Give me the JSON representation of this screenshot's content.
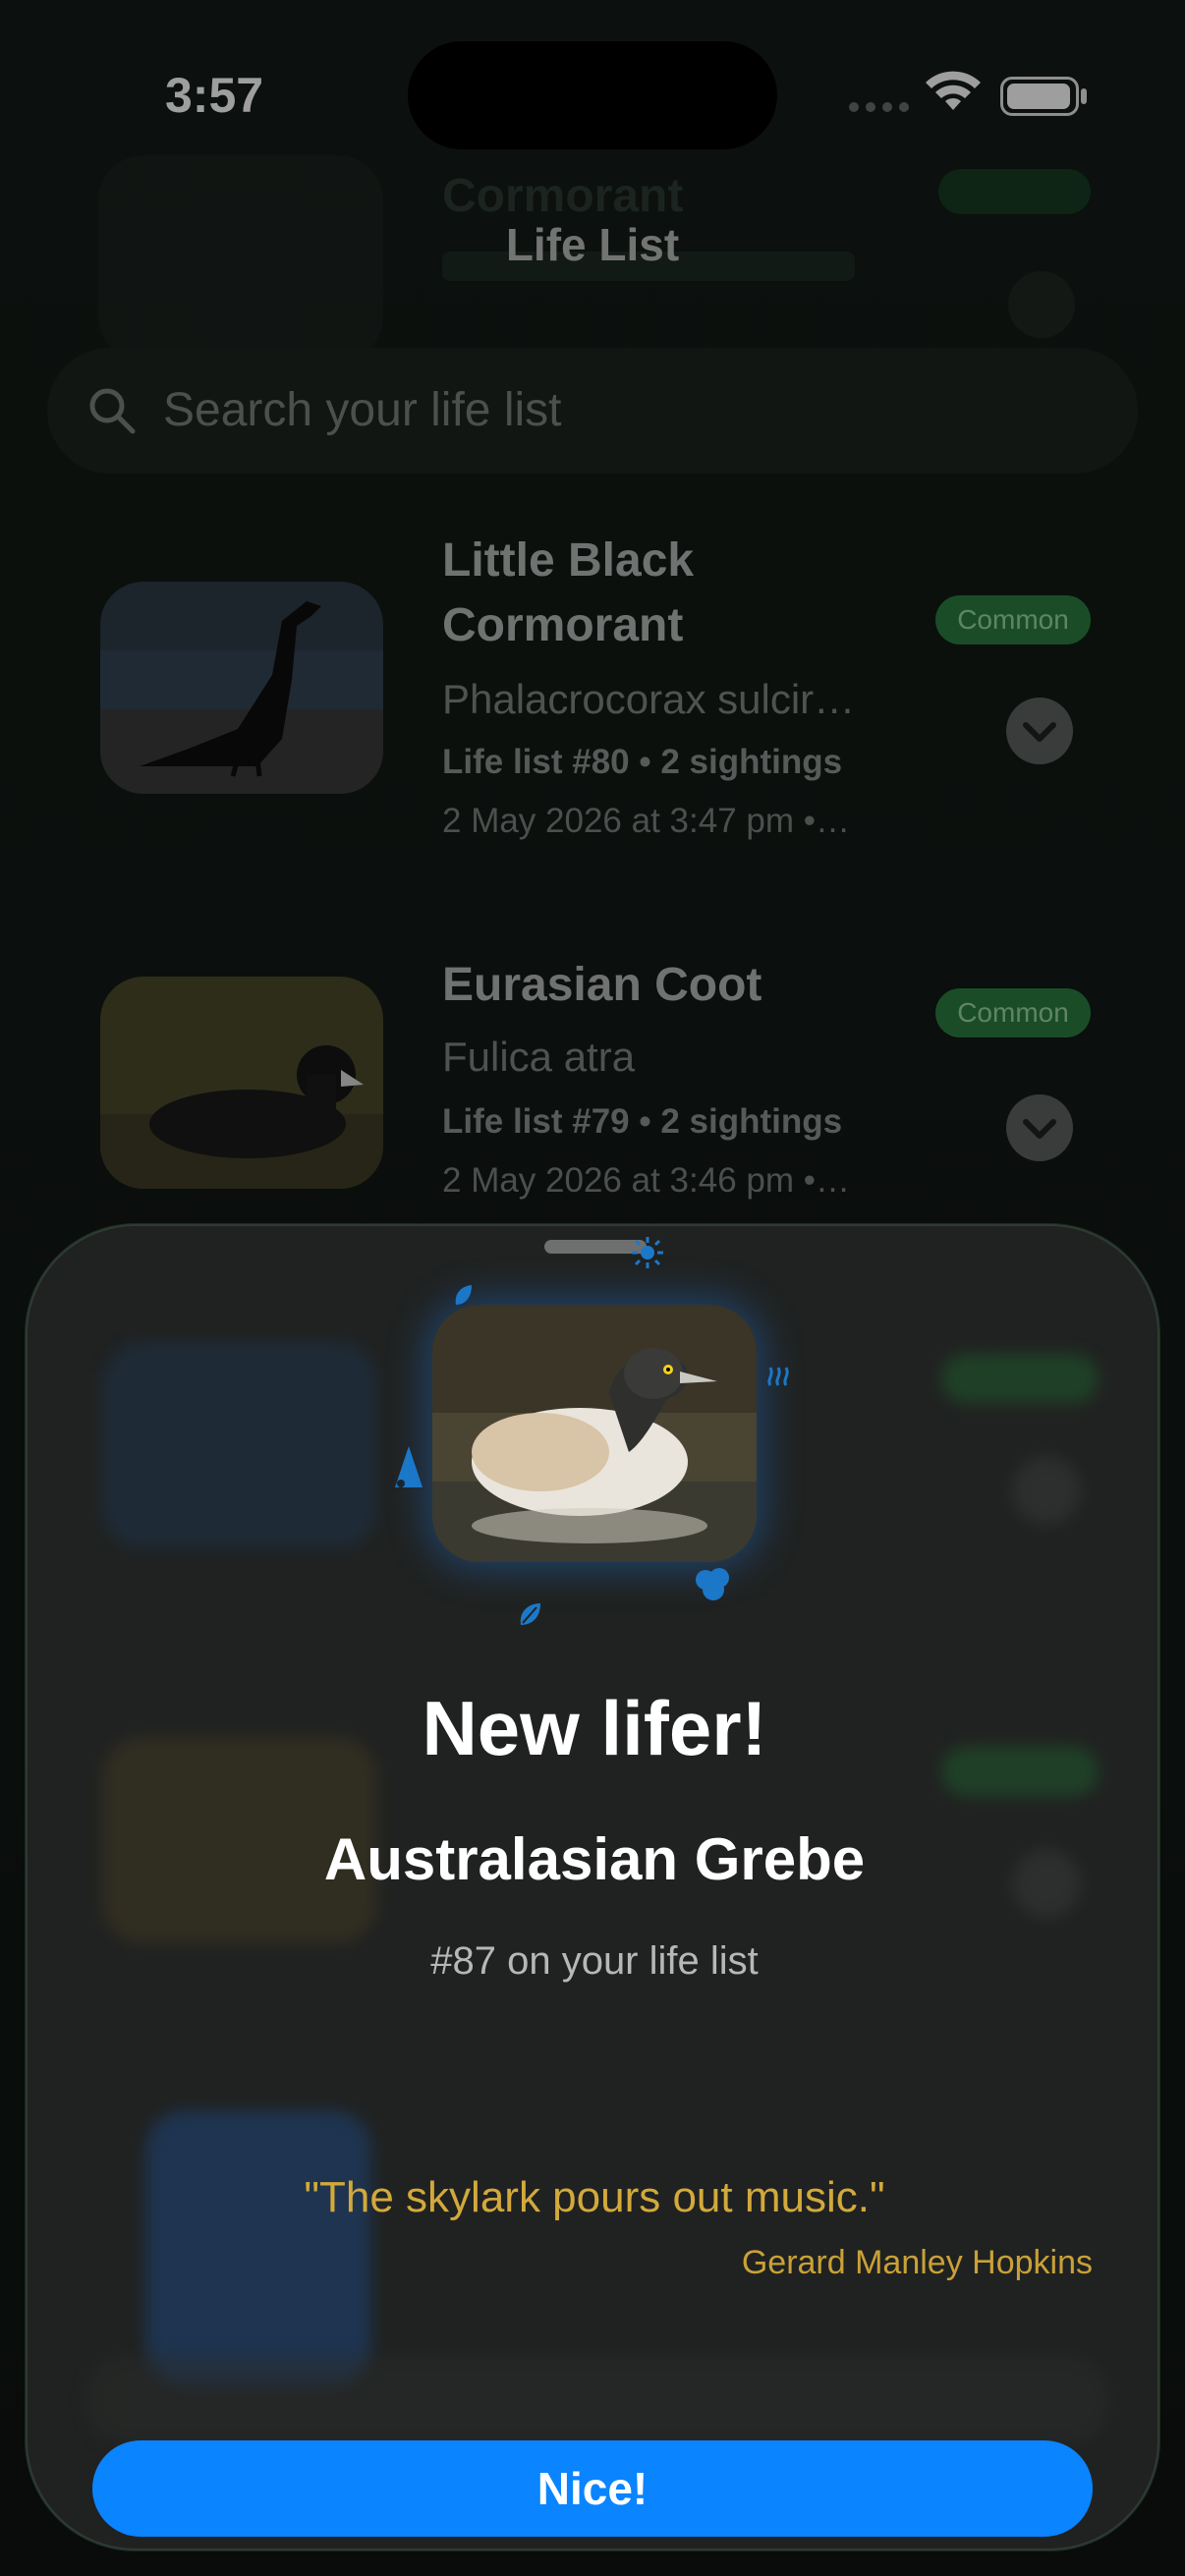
{
  "status_bar": {
    "time": "3:57"
  },
  "nav": {
    "title": "Life List"
  },
  "search": {
    "placeholder": "Search your life list"
  },
  "ghost_row": {
    "title": "Cormorant"
  },
  "list": [
    {
      "name_line1": "Little Black",
      "name_line2": "Cormorant",
      "scientific": "Phalacrocorax sulcir…",
      "meta": "Life list #80 • 2 sightings",
      "date": "2 May 2026 at 3:47 pm •…",
      "badge": "Common"
    },
    {
      "name_line1": "Eurasian Coot",
      "scientific": "Fulica atra",
      "meta": "Life list #79 • 2 sightings",
      "date": "2 May 2026 at 3:46 pm •…",
      "badge": "Common"
    }
  ],
  "sheet": {
    "title": "New lifer!",
    "species": "Australasian Grebe",
    "rank": "#87 on your life list",
    "quote": "\"The skylark pours out music.\"",
    "quote_author": "Gerard Manley Hopkins",
    "button": "Nice!"
  },
  "colors": {
    "accent": "#0a84ff",
    "badge_green": "#2a7d3f",
    "quote_gold": "#d2a93b",
    "confetti_blue": "#1c79c9"
  }
}
